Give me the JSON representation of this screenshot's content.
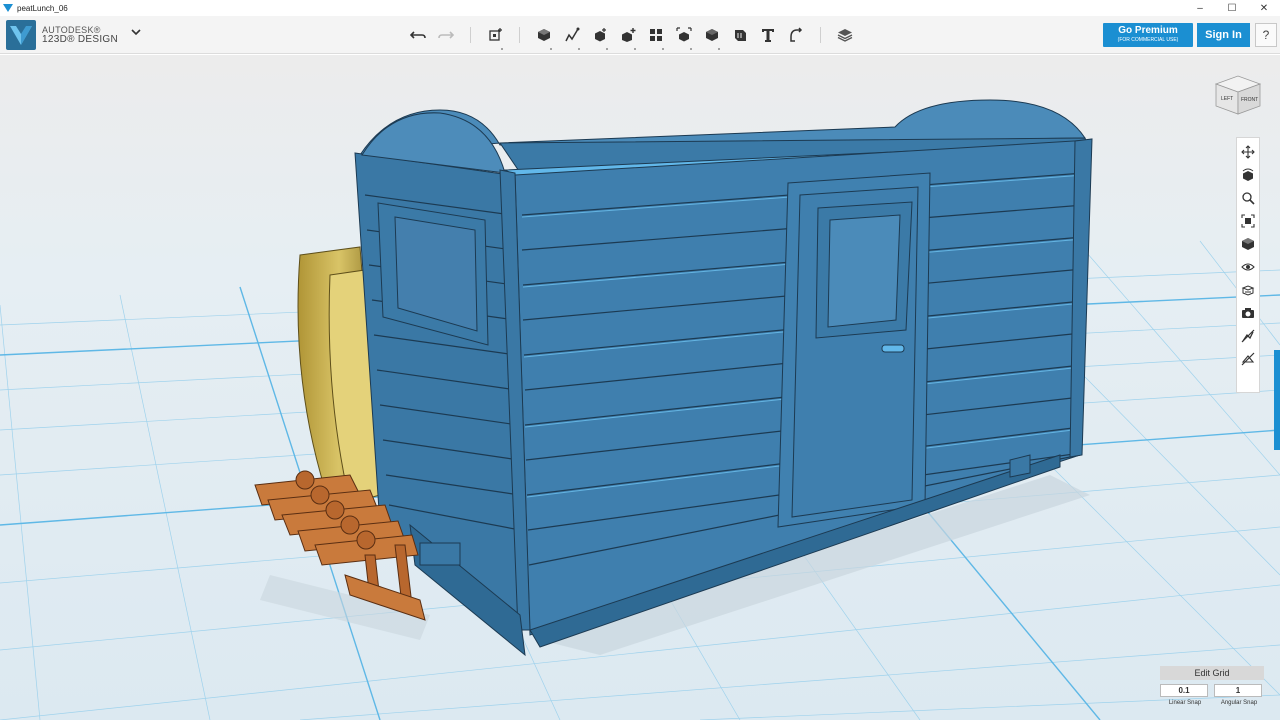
{
  "window": {
    "title": "peatLunch_06",
    "controls": [
      "–",
      "☐",
      "✕"
    ]
  },
  "brand": {
    "line1": "AUTODESK®",
    "line2": "123D® DESIGN"
  },
  "toolbar": {
    "tools": [
      {
        "name": "undo-icon"
      },
      {
        "name": "redo-icon"
      },
      {
        "name": "transform-icon"
      },
      {
        "name": "primitives-icon"
      },
      {
        "name": "sketch-icon"
      },
      {
        "name": "construct-icon"
      },
      {
        "name": "modify-icon"
      },
      {
        "name": "pattern-icon"
      },
      {
        "name": "grouping-icon"
      },
      {
        "name": "combine-icon"
      },
      {
        "name": "measure-icon"
      },
      {
        "name": "text-icon"
      },
      {
        "name": "snap-icon"
      },
      {
        "name": "material-icon"
      }
    ],
    "premium_label": "Go Premium",
    "premium_sub": "(FOR COMMERCIAL USE)",
    "signin_label": "Sign In",
    "help_label": "?"
  },
  "viewcube": {
    "left_face": "LEFT",
    "front_face": "FRONT"
  },
  "navbar": {
    "items": [
      "pan-icon",
      "orbit-icon",
      "zoom-icon",
      "fit-icon",
      "view-icon",
      "visibility-icon",
      "materials-outline-icon",
      "camera-icon",
      "hide-sketch-icon",
      "hide-mesh-icon"
    ]
  },
  "grid": {
    "edit_label": "Edit Grid",
    "linear_snap_value": "0.1",
    "linear_snap_label": "Linear Snap",
    "angular_snap_value": "1",
    "angular_snap_label": "Angular Snap"
  },
  "colors": {
    "accent": "#1b8fd2",
    "model_blue": "#3f7fae",
    "model_highlight": "#62b8ea",
    "yellow_part": "#c9b24a",
    "copper_part": "#c7753a",
    "grid_line": "#7fc3e6",
    "floor": "#e4eef4"
  }
}
